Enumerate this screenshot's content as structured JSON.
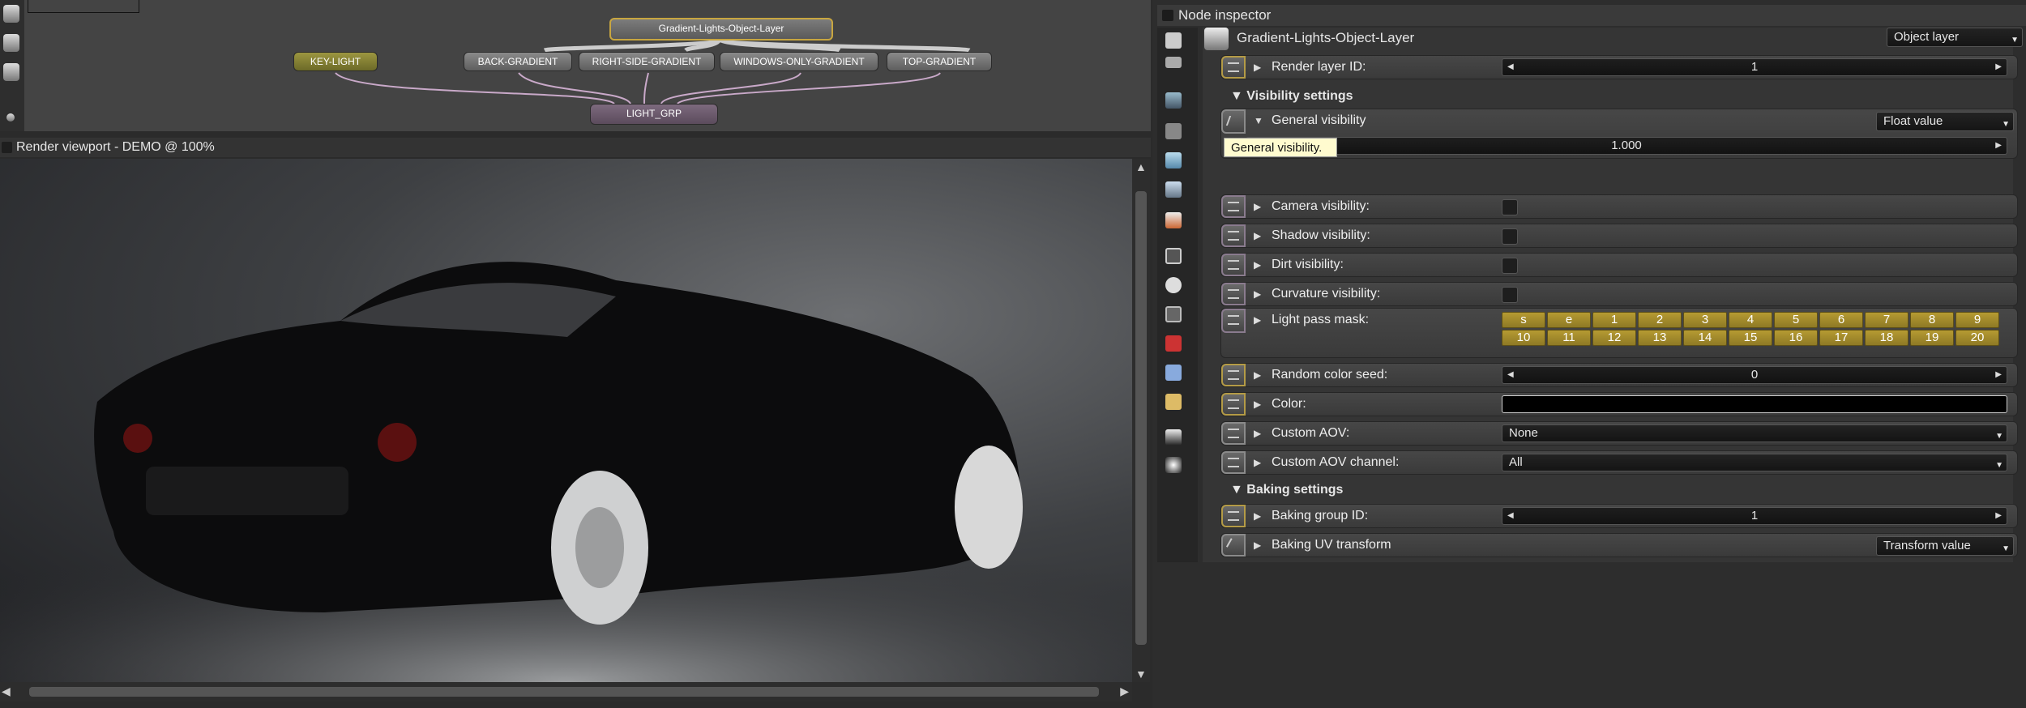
{
  "node_graph": {
    "nodes": {
      "object_layer": "Gradient-Lights-Object-Layer",
      "key_light": "KEY-LIGHT",
      "back_gradient": "BACK-GRADIENT",
      "right_side_gradient": "RIGHT-SIDE-GRADIENT",
      "windows_only_gradient": "WINDOWS-ONLY-GRADIENT",
      "top_gradient": "TOP-GRADIENT",
      "light_grp": "LIGHT_GRP"
    }
  },
  "viewport": {
    "title": "Render viewport - DEMO @ 100%"
  },
  "inspector": {
    "title": "Node inspector",
    "node_name": "Gradient-Lights-Object-Layer",
    "node_type": "Object layer",
    "render_layer_id": {
      "label": "Render layer ID:",
      "value": "1"
    },
    "visibility_section": "Visibility settings",
    "general_visibility": {
      "label": "General visibility",
      "mode": "Float value",
      "value": "1.000",
      "tooltip": "General visibility."
    },
    "camera_visibility": {
      "label": "Camera visibility:"
    },
    "shadow_visibility": {
      "label": "Shadow visibility:"
    },
    "dirt_visibility": {
      "label": "Dirt visibility:"
    },
    "curvature_visibility": {
      "label": "Curvature visibility:"
    },
    "light_pass_mask": {
      "label": "Light pass mask:",
      "buttons": [
        "s",
        "e",
        "1",
        "2",
        "3",
        "4",
        "5",
        "6",
        "7",
        "8",
        "9",
        "10",
        "11",
        "12",
        "13",
        "14",
        "15",
        "16",
        "17",
        "18",
        "19",
        "20"
      ]
    },
    "random_color_seed": {
      "label": "Random color seed:",
      "value": "0"
    },
    "color": {
      "label": "Color:",
      "value": "#000000"
    },
    "custom_aov": {
      "label": "Custom AOV:",
      "value": "None"
    },
    "custom_aov_channel": {
      "label": "Custom AOV channel:",
      "value": "All"
    },
    "baking_section": "Baking settings",
    "baking_group_id": {
      "label": "Baking group ID:",
      "value": "1"
    },
    "baking_uv_transform": {
      "label": "Baking UV transform",
      "mode": "Transform value"
    }
  },
  "colors": {
    "accent_gold": "#b59a32",
    "panel": "#353535",
    "tooltip": "#fffbcf"
  }
}
